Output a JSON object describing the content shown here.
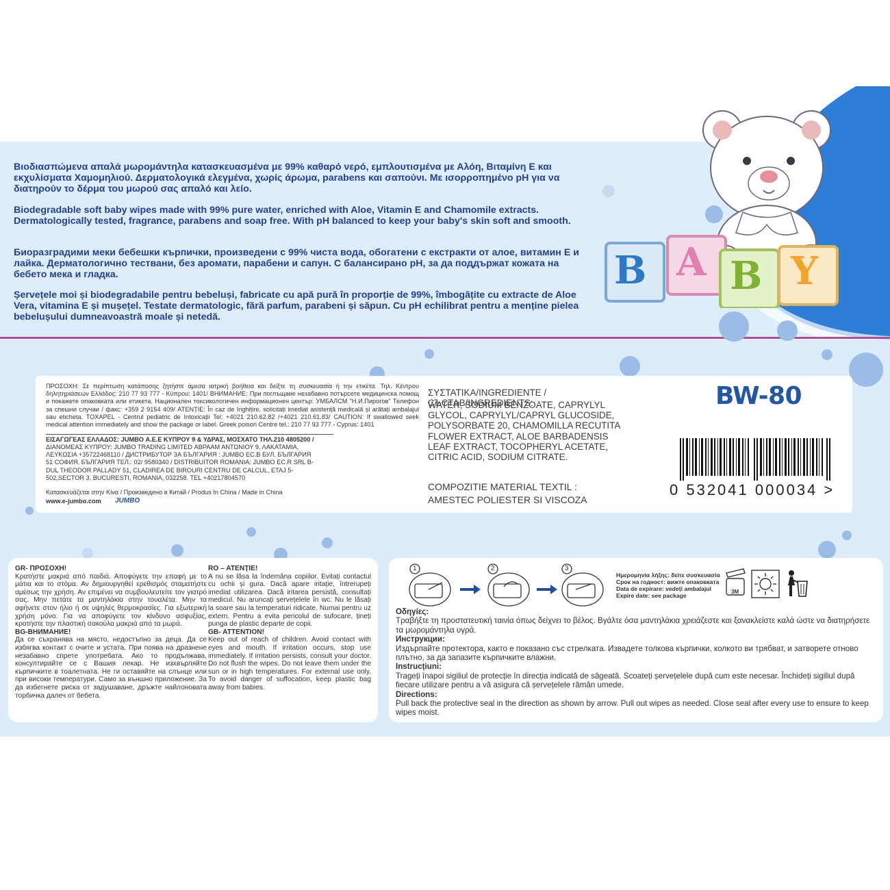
{
  "description": {
    "greek": "Βιοδιασπώμενα απαλά μωρομάντηλα κατασκευασμένα με 99% καθαρό νερό, εμπλουτισμένα με Αλόη, Βιταμίνη Ε και εκχυλίσματα Χαμομηλιού. Δερματολογικά ελεγμένα, χωρίς άρωμα, parabens και σαπούνι. Με ισορροπημένο pH για να διατηρούν το δέρμα του μωρού σας απαλό και λείο.",
    "english": "Biodegradable soft baby wipes made with 99% pure water, enriched with Aloe, Vitamin E and Chamomile extracts. Dermatologically tested, fragrance, parabens and soap free. With pH balanced to keep your baby's skin soft and smooth.",
    "bulgarian": "Биоразградими меки бебешки кърпички, произведени с 99% чиста вода, обогатени с екстракти от алое, витамин Е и лайка. Дерматологично тествани, без аромати, парабени и сапун. С балансирано pH, за да поддържат кожата на бебето мека и гладка.",
    "romanian": "Șervețele moi și biodegradabile pentru bebeluși, fabricate cu apă pură în proporție de 99%, îmbogățite cu extracte de Aloe Vera, vitamina E și mușețel. Testate dermatologic, fără parfum, parabeni și săpun. Cu pH echilibrat pentru a menține pielea bebelușului dumneavoastră moale și netedă."
  },
  "blocks": {
    "b1": "B",
    "a": "A",
    "b2": "B",
    "y": "Y"
  },
  "info": {
    "line1": "ΠΡΟΣΟΧΗ: Σε περίπτωση κατάποσης ζητήστε άμεσα ιατρική βοήθεια και δείξτε τη συσκευασία ή την ετικέτα. Τηλ. Κέντρου δηλητηριάσεων Ελλάδος: 210 77 93 777 - Κύπρου: 1401/ ВНИМАНИЕ: При поглъщане незабавно потърсете медицинска помощ и покажете опаковката или етикета. Национален токсикологичен информационен център: УМБАЛСМ \"Н.И.Пирогов\" Телефон за спешни случаи / факс: +359 2 9154 409/ ATENȚIE: În caz de înghițire, solicitați imediat asistență medicală și arătați ambalajul sau eticheta. TOXAPEL - Centrul pediatric de Intoxicații Tel: +4021 210.62.82 /+4021 210.61.83/ CAUTION: If swallowed seek medical attention immediately and show the package or label. Greek poison Centre tel.: 210 77 93 777 - Cyprus: 1401",
    "importer": "ΕΙΣΑΓΩΓΕΑΣ ΕΛΛΑΔΟΣ: JUMBO Α.Ε.Ε ΚΥΠΡΟΥ 9 & ΥΔΡΑΣ, ΜΟΣΧΑΤΟ ΤΗΛ.210 4805200 /",
    "distributor": "ΔΙΑΝΟΜΕΑΣ ΚΥΠΡΟΥ: JUMBO TRADING LIMITED ΑΒΡΑΑΜ ΑΝΤΩΝΙΟΥ 9, ΛΑΚΑΤΑΜΙΑ, ΛΕΥΚΩΣΙΑ +35722468110 / ДИСТРИБУТОР ЗА БЪЛГАРИЯ : JUMBO ЕС.В БУЛ. БЪЛГАРИЯ 51 СОФИЯ, БЪЛГАРИЯ ТЕЛ.: 02/ 9580340 / DISTRIBUITOR ROMANIA: JUMBO EC.R SRL B-DUL THEODOR PALLADY 51, CLADIREA DE BIROURI CENTRU DE CALCUL, ETAJ 5-502,SECTOR 3, BUCURESTI, ROMANIA, 032258. TEL +40217804570",
    "made_in": "Κατασκευάζεται στην Κίνα / Произведено в Китай / Produs în China / Made in China",
    "website": "www.e-jumbo.com",
    "logo": "JUMBO"
  },
  "ingredients": {
    "title": "ΣΥΣΤΑΤΙΚΑ/INGREDIENTE / СЪСТАВ/INGREDIENTS:",
    "list": "WATER, SODIUM BENZOATE, CAPRYLYL GLYCOL, CAPRYLYL/CAPRYL GLUCOSIDE, POLYSORBATE 20, CHAMOMILLA RECUTITA FLOWER EXTRACT, ALOE BARBADENSIS LEAF EXTRACT, TOCOPHERYL ACETATE, CITRIC ACID, SODIUM CITRATE.",
    "textile_title": "COMPOZITIE MATERIAL TEXTIL :",
    "textile_value": "AMESTEC POLIESTER SI VISCOZA"
  },
  "product_code": "BW-80",
  "barcode": {
    "digits": "0  532041  000034  >"
  },
  "warnings": {
    "gr_title": "GR- ΠΡΟΣΟΧΗ!",
    "gr_text": "Κρατήστε μακριά από παιδιά. Αποφύγετε την επαφή με το μάτια και το στόμα. Αν δημιουργηθεί ερεθισμός σταματήστε αμέσως την χρήση. Αν επιμένει να συμβουλευτείτε τον γιατρό σας. Μην πετάτε τα μαντηλάκια στην τουαλέτα. Μην τα αφήνετε στον ήλιο ή σε υψηλές θερμοκρασίες. Για εξωτερική χρήση μόνο. Για να αποφύγετε τον κίνδυνο ασφυξίας, κρατήστε την πλαστική σακούλα μακριά από τα μωρά.",
    "bg_title": "BG-ВНИМАНИЕ!",
    "bg_text": "Да се съхранява на място, недостъпно за деца. Да се избягва контакт с очите и устата. При поява на дразнене незабавно спрете употребата. Ако то продължава, консултирайте се с Вашия лекар. Не изхвърляйте кърпичките в тоалетната. Не ги оставяйте на слънце или при високи температури. Само за външно приложение. За да избегнете риска от задушаване, дръжте найлоновата торбичка далеч от бебета.",
    "ro_title": "RO – ATENȚIE!",
    "ro_text": "A nu se lăsa la îndemâna copiilor. Evitați contactul cu ochii și gura. Dacă apare iritație, întrerupeți imediat utilizarea. Dacă iritarea persistă, consultați medicul. Nu aruncați șervețelele în wc. Nu le lăsați la soare sau la temperaturi ridicate. Numai pentru uz extern. Pentru a evita pericolul de sufocare, țineți punga de plastic departe de copii.",
    "gb_title": "GB- ATTENTION!",
    "gb_text": "Keep out of reach of children. Avoid contact with eyes and mouth. If irritation occurs, stop use immediately. If irritation persists, consult your doctor. Do not flush the wipes. Do not leave them under the sun or in high temperatures. For external use only. To avoid danger of suffocation, keep plastic bag away from babies."
  },
  "expiry": {
    "gr": "Ημερομηνία λήξης: δείτε συσκευασία",
    "bg": "Срок на годност: вижте опаковката",
    "ro": "Data de expirare: vedeți ambalajul",
    "en": "Expire date: see package",
    "months": "3M"
  },
  "steps": [
    "1",
    "2",
    "3"
  ],
  "directions": {
    "gr_title": "Οδηγίες:",
    "gr_text": "Τραβήξτε τη προστατευτική ταινία όπως δείχνει το βέλος. Βγάλτε όσα μαντηλάκια χρειάζεστε και ξανακλείστε καλά ώστε να διατηρήσετε τα μωρομάντηλα υγρά.",
    "bg_title": "Инструкции:",
    "bg_text": "Издърпайте протектора, както е показано със стрелката. Извадете толкова кърпички, колкото ви трябват, и затворете отново плътно, за да запазите кърпичките влажни.",
    "ro_title": "Instrucțiuni:",
    "ro_text": "Trageți înapoi sigiliul de protecție în direcția indicată de săgeată. Scoateți șervețelele după cum este necesar. Închideți sigiliul după fiecare utilizare pentru a vă asigura că șervețelele rămân umede.",
    "en_title": "Directions:",
    "en_text": "Pull back the protective seal in the direction as shown by arrow. Pull out wipes as needed. Close seal after every use to ensure to keep wipes moist."
  },
  "colors": {
    "text_blue": "#243f98",
    "band": "#ddeefa",
    "accent_blue": "#2c7ed6",
    "pink_line": "#b04e95"
  }
}
